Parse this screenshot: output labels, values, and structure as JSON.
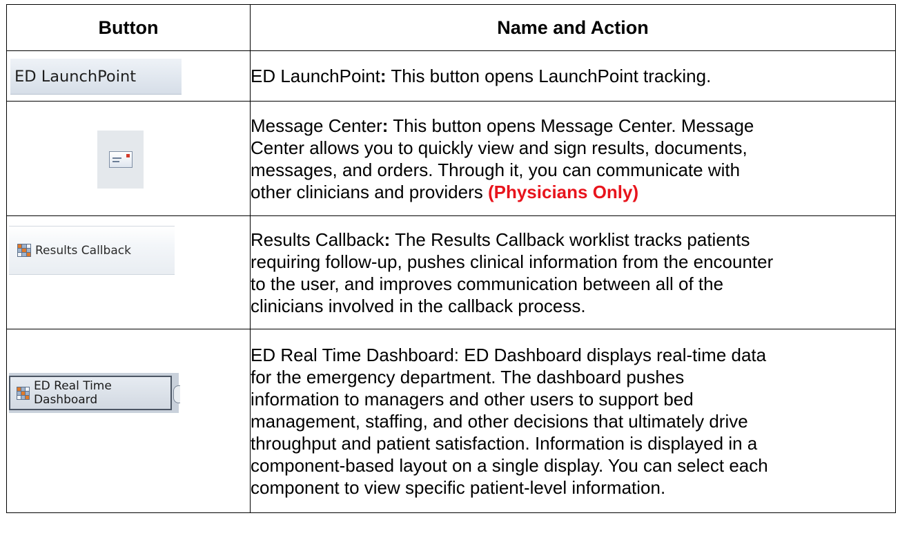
{
  "headers": {
    "button": "Button",
    "name_action": "Name and Action"
  },
  "rows": [
    {
      "button_image_label": "ED LaunchPoint",
      "name": "ED LaunchPoint",
      "sep": ":",
      "lines": [
        "ED LaunchPoint: This button opens LaunchPoint tracking."
      ]
    },
    {
      "button_image_label": "",
      "icon": "envelope-icon",
      "name": "Message Center",
      "lines": [
        "Message Center: This button opens Message Center. Message",
        "Center allows you to quickly view and sign results, documents,",
        "messages, and orders. Through it, you can communicate with",
        "other clinicians and providers"
      ],
      "note": "(Physicians Only)"
    },
    {
      "button_image_label": "Results Callback",
      "icon": "grid-icon",
      "name": "Results Callback",
      "lines": [
        "Results Callback: The Results Callback worklist tracks patients",
        "requiring follow-up, pushes clinical information from the encounter",
        "to the user, and improves communication between all of the",
        "clinicians involved in the callback process."
      ]
    },
    {
      "button_image_label": "ED Real Time Dashboard",
      "icon": "grid-icon",
      "name": "ED Real Time Dashboard",
      "lines": [
        "ED Real Time Dashboard: ED Dashboard displays real-time data",
        "for the emergency department. The dashboard pushes",
        "information to managers and other users to support bed",
        "management, staffing, and other decisions that ultimately drive",
        "throughput and patient satisfaction. Information is displayed in a",
        "component-based layout on a single display. You can select each",
        "component to view specific patient-level information."
      ]
    }
  ],
  "colors": {
    "note": "#e8141c",
    "border": "#000000"
  }
}
